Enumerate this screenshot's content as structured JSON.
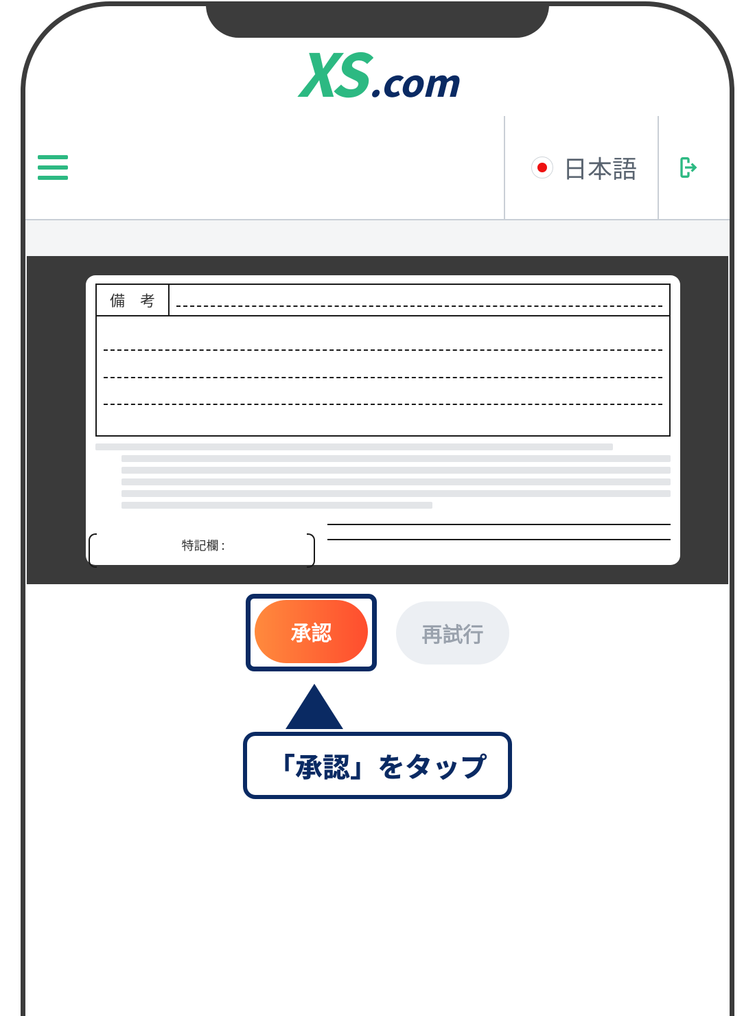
{
  "logo": {
    "xs": "XS",
    "dotcom": ".com"
  },
  "header": {
    "language_label": "日本語"
  },
  "document": {
    "remarks_header": "備　考",
    "special_label": "特記欄 :"
  },
  "actions": {
    "approve_label": "承認",
    "retry_label": "再試行"
  },
  "callout": {
    "text": "「承認」をタップ"
  },
  "colors": {
    "brand_green": "#2cb982",
    "brand_navy": "#0e2a5a",
    "approve_gradient_from": "#ff8a3d",
    "approve_gradient_to": "#ff4d2e"
  }
}
